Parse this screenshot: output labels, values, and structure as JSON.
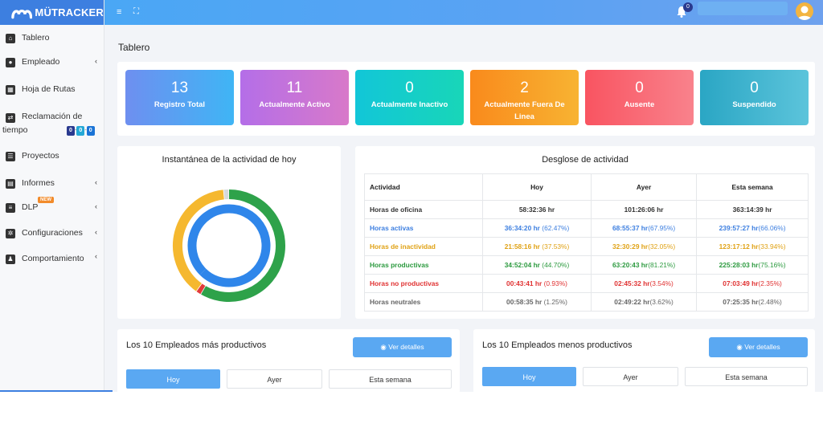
{
  "brand": {
    "name": "MÜTRACKER"
  },
  "colors": {
    "brand": "#3d7fe0",
    "active": "#4ba2f5",
    "inactive": "#f5b82f",
    "productive": "#2ea24a"
  },
  "topbar": {
    "menu_icon": "hamburger-icon",
    "expand_icon": "expand-icon",
    "notification_count": "0"
  },
  "sidebar": {
    "items": [
      {
        "label": "Tablero",
        "icon": "home-icon"
      },
      {
        "label": "Empleado",
        "icon": "user-icon",
        "arrow": "‹"
      },
      {
        "label": "Hoja de Rutas",
        "icon": "calendar-icon"
      },
      {
        "label": "Reclamación de",
        "label2": "tiempo",
        "icon": "exchange-icon",
        "badges": [
          "0",
          "0",
          "0"
        ]
      },
      {
        "label": "Proyectos",
        "icon": "list-icon"
      },
      {
        "label": "Informes",
        "icon": "report-icon",
        "arrow": "‹"
      },
      {
        "label": "DLP",
        "icon": "sliders-icon",
        "badge": "NEW",
        "arrow": "‹"
      },
      {
        "label": "Configuraciones",
        "icon": "gear-icon",
        "arrow": "‹"
      },
      {
        "label": "Comportamiento",
        "icon": "users-gear-icon",
        "arrow": "‹"
      }
    ]
  },
  "page": {
    "title": "Tablero"
  },
  "cards": [
    {
      "value": "13",
      "label": "Registro Total"
    },
    {
      "value": "11",
      "label": "Actualmente Activo"
    },
    {
      "value": "0",
      "label": "Actualmente Inactivo"
    },
    {
      "value": "2",
      "label": "Actualmente Fuera De Linea"
    },
    {
      "value": "0",
      "label": "Ausente"
    },
    {
      "value": "0",
      "label": "Suspendido"
    }
  ],
  "snapshot": {
    "title": "Instantánea de la actividad de hoy",
    "outer_ring": [
      {
        "name": "Horas productivas",
        "percent": 58.5,
        "color": "#2ea24a"
      },
      {
        "name": "Horas no productivas",
        "percent": 1.5,
        "color": "#e23b3b"
      },
      {
        "name": "Horas de inactividad",
        "percent": 38.5,
        "color": "#f5b82f"
      },
      {
        "name": "Horas neutrales",
        "percent": 1.5,
        "color": "#d6d9dc"
      }
    ],
    "inner_ring": [
      {
        "name": "Horas activas",
        "percent": 62.47,
        "color": "#2f86ea"
      },
      {
        "name": "Horas activas",
        "percent": 37.53,
        "color": "#2f86ea"
      }
    ]
  },
  "breakdown": {
    "title": "Desglose de actividad",
    "columns": [
      "Actividad",
      "Hoy",
      "Ayer",
      "Esta semana"
    ],
    "rows": [
      {
        "label": "Horas de oficina",
        "cls": "c-dark",
        "cells": [
          [
            "58:32:36 hr",
            ""
          ],
          [
            "101:26:06 hr",
            ""
          ],
          [
            "363:14:39 hr",
            ""
          ]
        ]
      },
      {
        "label": "Horas activas",
        "cls": "c-blue",
        "cells": [
          [
            "36:34:20 hr",
            " (62.47%)"
          ],
          [
            "68:55:37 hr",
            "(67.95%)"
          ],
          [
            "239:57:27 hr",
            "(66.06%)"
          ]
        ]
      },
      {
        "label": "Horas de inactividad",
        "cls": "c-orange",
        "cells": [
          [
            "21:58:16 hr",
            " (37.53%)"
          ],
          [
            "32:30:29 hr",
            "(32.05%)"
          ],
          [
            "123:17:12 hr",
            "(33.94%)"
          ]
        ]
      },
      {
        "label": "Horas productivas",
        "cls": "c-green",
        "cells": [
          [
            "34:52:04 hr",
            " (44.70%)"
          ],
          [
            "63:20:43 hr",
            "(81.21%)"
          ],
          [
            "225:28:03 hr",
            "(75.16%)"
          ]
        ]
      },
      {
        "label": "Horas no productivas",
        "cls": "c-red",
        "cells": [
          [
            "00:43:41 hr",
            " (0.93%)"
          ],
          [
            "02:45:32 hr",
            "(3.54%)"
          ],
          [
            "07:03:49 hr",
            "(2.35%)"
          ]
        ]
      },
      {
        "label": "Horas neutrales",
        "cls": "c-gray",
        "cells": [
          [
            "00:58:35 hr",
            " (1.25%)"
          ],
          [
            "02:49:22 hr",
            "(3.62%)"
          ],
          [
            "07:25:35 hr",
            "(2.48%)"
          ]
        ]
      }
    ]
  },
  "top_productive": {
    "title": "Los 10 Empleados más productivos",
    "details_label": "Ver detalles",
    "tabs": [
      "Hoy",
      "Ayer",
      "Esta semana"
    ]
  },
  "least_productive": {
    "title": "Los 10 Empleados menos productivos",
    "details_label": "Ver detalles",
    "tabs": [
      "Hoy",
      "Ayer",
      "Esta semana"
    ]
  }
}
